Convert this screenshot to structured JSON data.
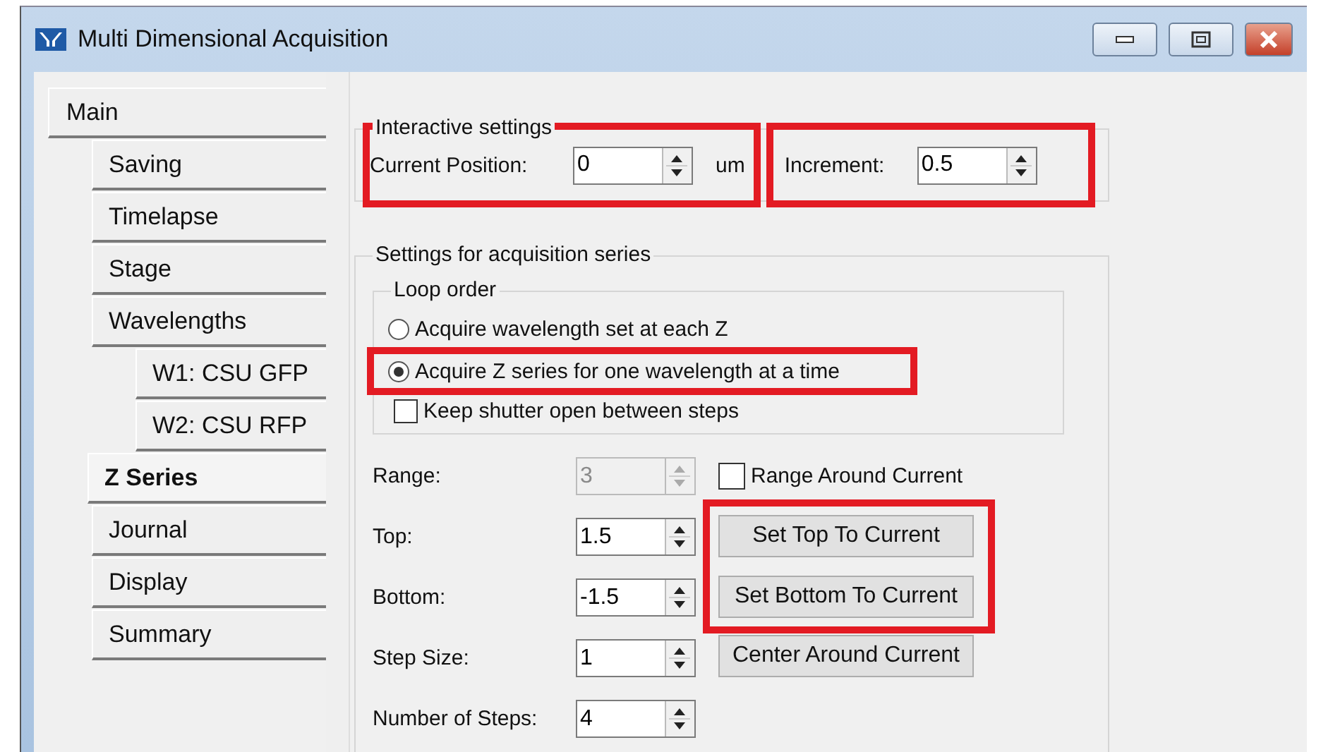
{
  "window": {
    "title": "Multi Dimensional Acquisition"
  },
  "sidebar": {
    "items": [
      {
        "label": "Main",
        "selected": false,
        "children": [
          {
            "label": "Saving",
            "selected": false
          },
          {
            "label": "Timelapse",
            "selected": false
          },
          {
            "label": "Stage",
            "selected": false
          },
          {
            "label": "Wavelengths",
            "selected": false,
            "children": [
              {
                "label": "W1: CSU GFP",
                "selected": false
              },
              {
                "label": "W2: CSU RFP",
                "selected": false
              }
            ]
          },
          {
            "label": "Z Series",
            "selected": true
          },
          {
            "label": "Journal",
            "selected": false
          },
          {
            "label": "Display",
            "selected": false
          },
          {
            "label": "Summary",
            "selected": false
          }
        ]
      }
    ]
  },
  "interactive_settings": {
    "title": "Interactive settings",
    "current_position": {
      "label": "Current Position:",
      "value": "0",
      "unit": "um",
      "highlighted": true
    },
    "increment": {
      "label": "Increment:",
      "value": "0.5",
      "highlighted": true
    }
  },
  "acquisition_series": {
    "title": "Settings for acquisition series",
    "loop_order": {
      "title": "Loop order",
      "options": [
        {
          "label": "Acquire wavelength set at each Z",
          "selected": false,
          "highlighted": false
        },
        {
          "label": "Acquire Z series for one wavelength at a time",
          "selected": true,
          "highlighted": true
        }
      ]
    },
    "keep_shutter": {
      "label": "Keep shutter open between steps",
      "checked": false
    },
    "range": {
      "label": "Range:",
      "value": "3",
      "disabled": true
    },
    "range_around_current": {
      "label": "Range Around Current",
      "checked": false
    },
    "fields": [
      {
        "label": "Top:",
        "value": "1.5"
      },
      {
        "label": "Bottom:",
        "value": "-1.5"
      },
      {
        "label": "Step Size:",
        "value": "1"
      },
      {
        "label": "Number of Steps:",
        "value": "4"
      }
    ],
    "buttons": [
      {
        "label": "Set Top To Current",
        "highlighted": true
      },
      {
        "label": "Set Bottom To Current",
        "highlighted": true
      },
      {
        "label": "Center Around Current",
        "highlighted": false
      }
    ]
  }
}
